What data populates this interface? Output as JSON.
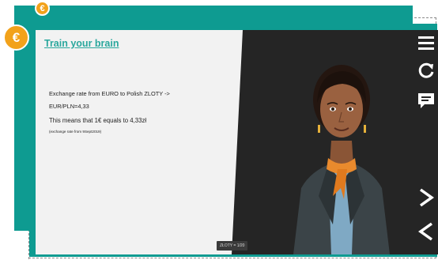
{
  "coins": {
    "small_symbol": "€",
    "large_symbol": "€"
  },
  "lesson": {
    "title": "Train your brain",
    "line1": "Exchange rate from EURO to Polish ZLOTY  ->",
    "line2": "EUR/PLN=4,33",
    "line3": "This means that 1€ equals to 4,33zł",
    "line4": "(exchange rate from 9Sept2019)"
  },
  "caption": {
    "text": "ZŁOTY = 1/20"
  },
  "toolbar": {
    "items": [
      {
        "icon": "menu-icon"
      },
      {
        "icon": "refresh-icon"
      },
      {
        "icon": "subtitles-icon"
      },
      {
        "icon": "next-icon"
      },
      {
        "icon": "previous-icon"
      }
    ]
  },
  "colors": {
    "teal": "#0e9b91",
    "coin": "#f2a21b",
    "link": "#2aa79d",
    "stage": "#252525"
  }
}
